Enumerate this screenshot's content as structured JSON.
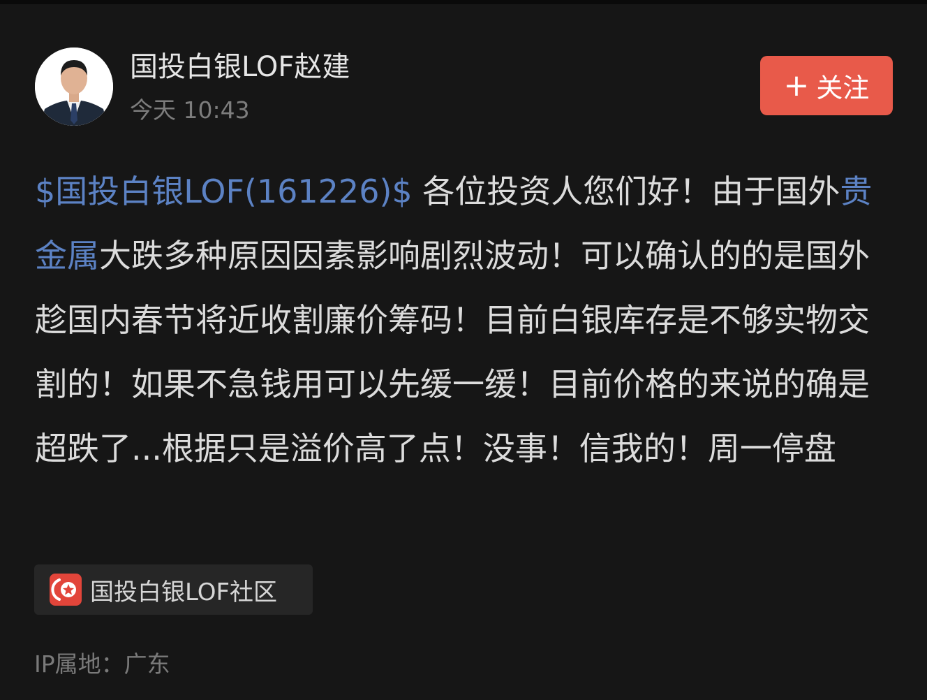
{
  "author": {
    "name": "国投白银LOF赵建",
    "time": "今天 10:43",
    "avatar_icon": "person-portrait-icon"
  },
  "follow_button": {
    "icon": "plus-icon",
    "plus_glyph": "+",
    "label": "关注",
    "color": "#e85a4a"
  },
  "post": {
    "stock_link": "$国投白银LOF(161226)$",
    "text_1": " 各位投资人您们好！由于国外",
    "topic_link": "贵金属",
    "text_2": "大跌多种原因因素影响剧烈波动！可以确认的的是国外趁国内春节将近收割廉价筹码！目前白银库存是不够实物交割的！如果不急钱用可以先缓一缓！目前价格的来说的确是超跌了...根据只是溢价高了点！没事！信我的！周一停盘",
    "link_color": "#5c82c4"
  },
  "community": {
    "icon": "community-logo-icon",
    "label": "国投白银LOF社区"
  },
  "ip_location": "IP属地：广东"
}
